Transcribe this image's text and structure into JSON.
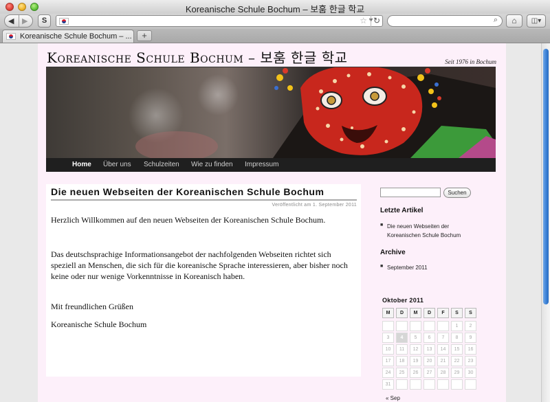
{
  "window": {
    "title": "Koreanische Schule Bochum – 보훔 한글 학교"
  },
  "toolbar": {
    "back_icon": "back-arrow-icon",
    "forward_icon": "forward-arrow-icon",
    "s_button_label": "S",
    "address_value": "",
    "search_value": "",
    "home_icon": "home-icon",
    "bookmarks_icon": "bookmarks-icon"
  },
  "tabs": [
    {
      "label": "Koreanische Schule Bochum – ..."
    }
  ],
  "site": {
    "title": "Koreanische Schule Bochum – 보훔 한글 학교",
    "tagline": "Seit 1976 in Bochum"
  },
  "nav": [
    "Home",
    "Über uns",
    "Schulzeiten",
    "Wie zu finden",
    "Impressum"
  ],
  "post": {
    "title": "Die neuen Webseiten der Koreanischen Schule Bochum",
    "meta": "Veröffentlicht am 1. September 2011",
    "paragraphs": [
      "Herzlich Willkommen auf den neuen Webseiten der Koreanischen Schule Bochum.",
      "Das deutschsprachige Informationsangebot der nachfolgenden Webseiten richtet sich speziell an Menschen, die sich für die koreanische Sprache interessieren, aber bisher noch keine oder nur wenige Vorkenntnisse in Koreanisch haben.",
      "Mit freundlichen Grüßen",
      "Koreanische Schule Bochum"
    ]
  },
  "sidebar": {
    "search_button": "Suchen",
    "recent_title": "Letzte Artikel",
    "recent_items": [
      "Die neuen Webseiten der Koreanischen Schule Bochum"
    ],
    "archive_title": "Archive",
    "archive_items": [
      "September 2011"
    ],
    "calendar": {
      "caption": "Oktober 2011",
      "weekdays": [
        "M",
        "D",
        "M",
        "D",
        "F",
        "S",
        "S"
      ],
      "today": 4,
      "rows": [
        [
          "",
          "",
          "",
          "",
          "",
          "1",
          "2"
        ],
        [
          "3",
          "4",
          "5",
          "6",
          "7",
          "8",
          "9"
        ],
        [
          "10",
          "11",
          "12",
          "13",
          "14",
          "15",
          "16"
        ],
        [
          "17",
          "18",
          "19",
          "20",
          "21",
          "22",
          "23"
        ],
        [
          "24",
          "25",
          "26",
          "27",
          "28",
          "29",
          "30"
        ],
        [
          "31",
          "",
          "",
          "",
          "",
          "",
          ""
        ]
      ],
      "prev_link": "« Sep"
    }
  },
  "colors": {
    "page_background": "#fdf0fa",
    "nav_background": "#1f1f1f",
    "scrollbar_thumb": "#3a7fd4"
  }
}
